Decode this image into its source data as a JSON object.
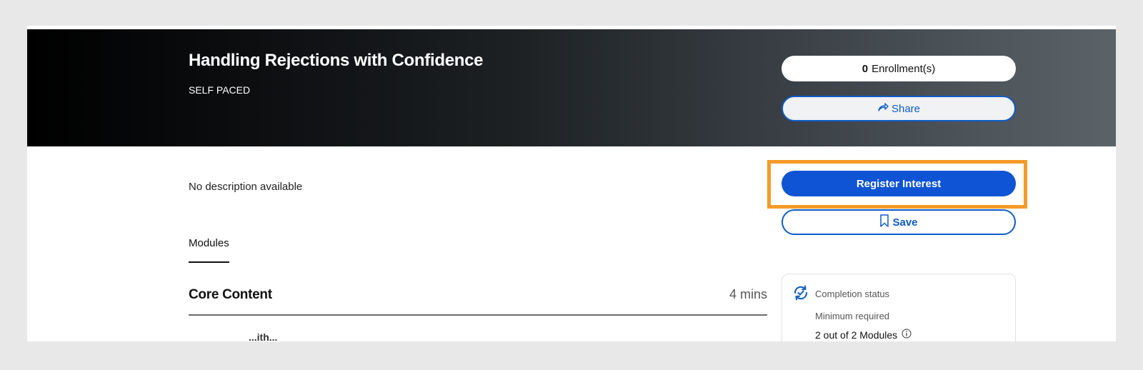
{
  "course": {
    "title": "Handling Rejections with Confidence",
    "type": "SELF PACED",
    "description": "No description available"
  },
  "enrollment": {
    "count": "0",
    "label": "Enrollment(s)"
  },
  "actions": {
    "share_label": "Share",
    "register_label": "Register Interest",
    "save_label": "Save"
  },
  "tabs": {
    "modules_label": "Modules"
  },
  "section": {
    "title": "Core Content",
    "duration": "4 mins",
    "first_module_partial": "...ith..."
  },
  "completion": {
    "status_label": "Completion status",
    "minimum_label": "Minimum required",
    "minimum_value": "2 out of 2 Modules"
  },
  "icons": {
    "share": "share-arrow-icon",
    "save": "bookmark-icon",
    "completion": "sync-check-icon",
    "info": "info-icon"
  },
  "colors": {
    "accent_blue": "#0e54d4",
    "highlight_orange": "#f59a2a"
  }
}
